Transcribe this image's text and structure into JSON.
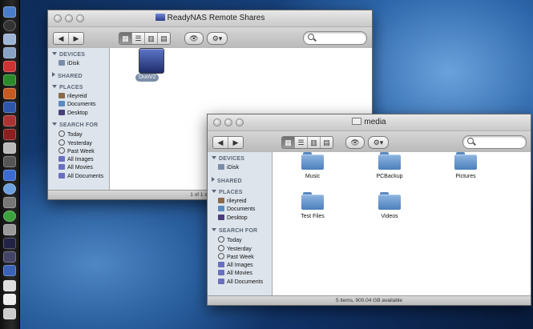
{
  "window_back": {
    "title": "ReadyNAS Remote Shares",
    "sidebar": {
      "devices_header": "DEVICES",
      "devices": [
        "iDisk"
      ],
      "shared_header": "SHARED",
      "places_header": "PLACES",
      "places": [
        "rileyreid",
        "Documents",
        "Desktop"
      ],
      "search_header": "SEARCH FOR",
      "search_items": [
        "Today",
        "Yesterday",
        "Past Week",
        "All Images",
        "All Movies",
        "All Documents"
      ]
    },
    "items": [
      {
        "label": "DuoV2"
      }
    ],
    "status": "1 of 1 selected, 8"
  },
  "window_front": {
    "title": "media",
    "sidebar": {
      "devices_header": "DEVICES",
      "devices": [
        "iDisk"
      ],
      "shared_header": "SHARED",
      "places_header": "PLACES",
      "places": [
        "rileyreid",
        "Documents",
        "Desktop"
      ],
      "search_header": "SEARCH FOR",
      "search_items": [
        "Today",
        "Yesterday",
        "Past Week",
        "All Images",
        "All Movies",
        "All Documents"
      ]
    },
    "folders": [
      {
        "label": "Music"
      },
      {
        "label": "PCBackup"
      },
      {
        "label": "Pictures"
      },
      {
        "label": "Test Files"
      },
      {
        "label": "Videos"
      }
    ],
    "status": "5 items, 900.04 GB available"
  },
  "toolbar": {
    "back_glyph": "◀",
    "forward_glyph": "▶",
    "eye_glyph": "👁",
    "action_glyph": "⚙▾",
    "search_placeholder": ""
  },
  "colors": {
    "sidebar_bg": "#dde4ec",
    "folder_blue": "#4b7fba",
    "selection": "#7d8ea8"
  }
}
